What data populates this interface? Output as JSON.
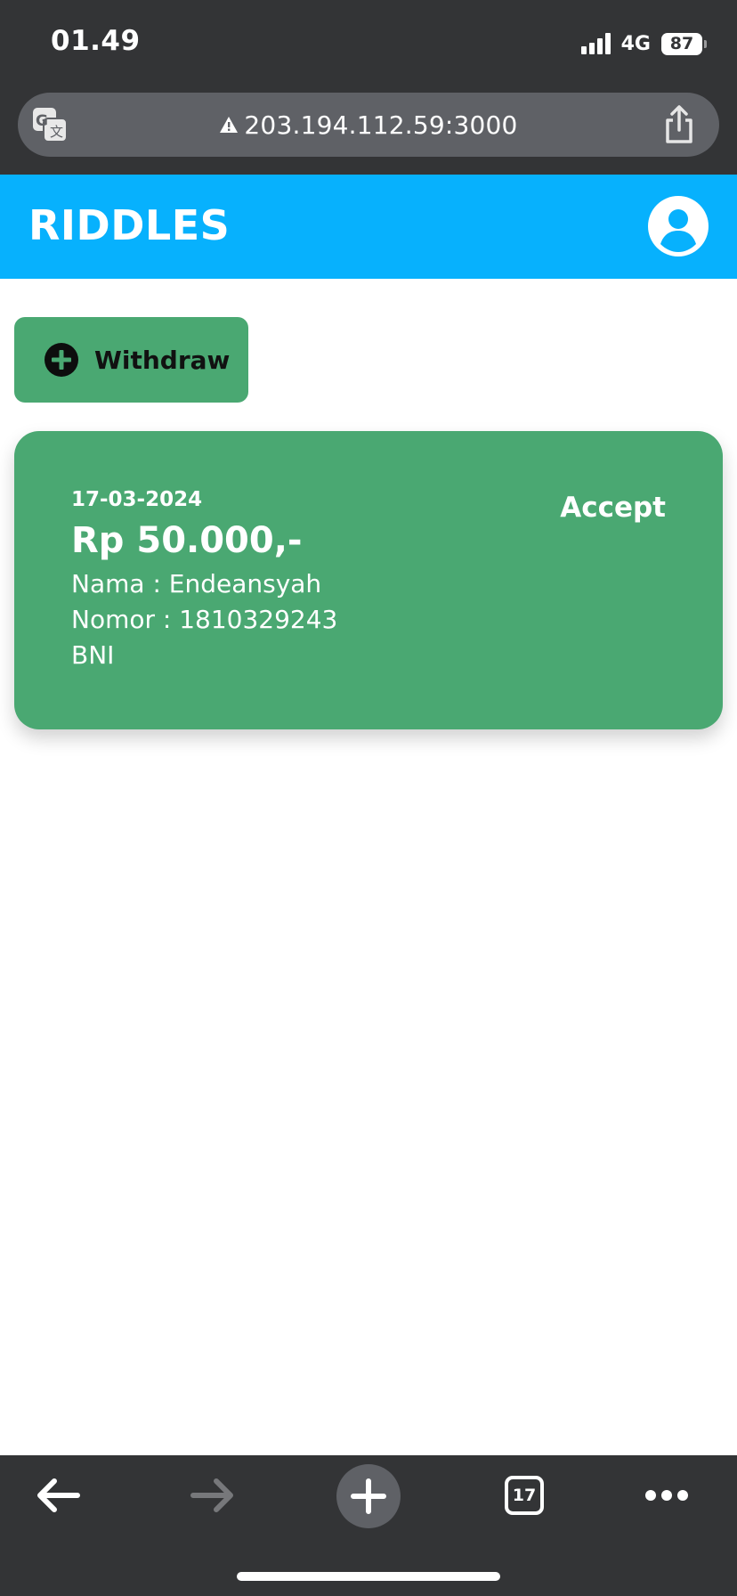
{
  "status_bar": {
    "time": "01.49",
    "network": "4G",
    "battery": "87"
  },
  "browser": {
    "url": "203.194.112.59:3000",
    "tab_count": "17",
    "icons": {
      "translate": "translate-icon",
      "warning": "warning-icon",
      "share": "share-icon",
      "back": "arrow-left-icon",
      "forward": "arrow-right-icon",
      "new_tab": "plus-icon",
      "tabs": "tabs-icon",
      "more": "more-dots-icon"
    }
  },
  "app": {
    "title": "RIDDLES",
    "header_color": "#07b1fd",
    "accent_color": "#4aa872"
  },
  "actions": {
    "withdraw_label": "Withdraw"
  },
  "withdrawals": [
    {
      "date": "17-03-2024",
      "amount": "Rp 50.000,-",
      "name": "Nama : Endeansyah",
      "number": "Nomor : 1810329243",
      "bank": "BNI",
      "status": "Accept"
    }
  ]
}
